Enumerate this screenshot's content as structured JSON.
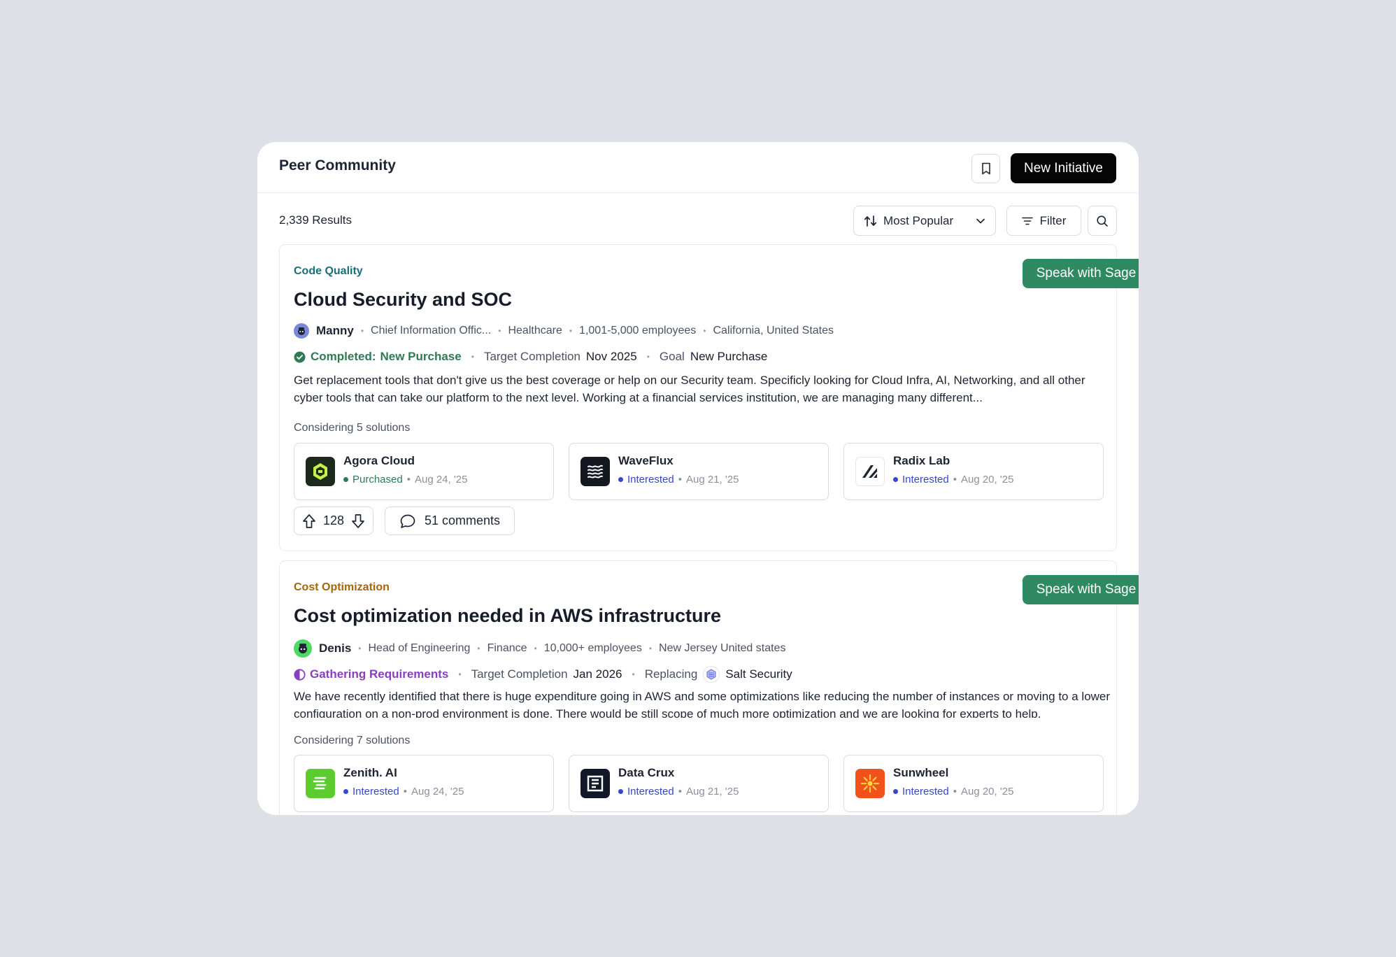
{
  "header": {
    "title": "Peer Community",
    "new_initiative_label": "New Initiative"
  },
  "toolbar": {
    "results": "2,339 Results",
    "sort_label": "Most Popular",
    "filter_label": "Filter"
  },
  "initiatives": [
    {
      "category": "Code Quality",
      "category_color": "#1b6e7a",
      "speak_label": "Speak with Sage",
      "title": "Cloud Security and SOC",
      "author": "Manny",
      "role": "Chief Information Offic...",
      "industry": "Healthcare",
      "size": "1,001-5,000 employees",
      "location": "California, United States",
      "status_label": "Completed:",
      "status_value": "New Purchase",
      "status_color": "#2f7a55",
      "target_label": "Target Completion",
      "target_value": "Nov 2025",
      "goal_label": "Goal",
      "goal_value": "New Purchase",
      "description": "Get replacement tools that don't give us the best coverage or help on our Security team. Specificly looking for Cloud Infra, AI, Networking, and all other cyber tools that can take our platform to the next level. Working at a financial services institution, we are managing many different...",
      "considering": "Considering 5 solutions",
      "solutions": [
        {
          "name": "Agora Cloud",
          "status": "Purchased",
          "status_color": "#2f7a55",
          "date": "Aug 24, '25",
          "icon": "agora-cloud-logo"
        },
        {
          "name": "WaveFlux",
          "status": "Interested",
          "status_color": "#3548c9",
          "date": "Aug 21, '25",
          "icon": "waveflux-logo"
        },
        {
          "name": "Radix Lab",
          "status": "Interested",
          "status_color": "#3548c9",
          "date": "Aug 20, '25",
          "icon": "radix-lab-logo"
        }
      ],
      "votes": "128",
      "comments": "51 comments"
    },
    {
      "category": "Cost Optimization",
      "category_color": "#a5650b",
      "speak_label": "Speak with Sage",
      "title": "Cost optimization needed in AWS infrastructure",
      "author": "Denis",
      "role": "Head of Engineering",
      "industry": "Finance",
      "size": "10,000+ employees",
      "location": "New Jersey United states",
      "status_label": "Gathering Requirements",
      "status_color": "#8a3fc0",
      "target_label": "Target Completion",
      "target_value": "Jan 2026",
      "replacing_label": "Replacing",
      "replacing_value": "Salt Security",
      "description": "We have recently identified that there is huge expenditure going in AWS and some optimizations like reducing the number of instances or moving to a lower configuration on a non-prod environment is done. There would be still scope of much more optimization and we are looking for experts to help.",
      "considering": "Considering 7 solutions",
      "solutions": [
        {
          "name": "Zenith. AI",
          "status": "Interested",
          "status_color": "#3548c9",
          "date": "Aug 24, '25",
          "icon": "zenith-ai-logo"
        },
        {
          "name": "Data Crux",
          "status": "Interested",
          "status_color": "#3548c9",
          "date": "Aug 21, '25",
          "icon": "data-crux-logo"
        },
        {
          "name": "Sunwheel",
          "status": "Interested",
          "status_color": "#3548c9",
          "date": "Aug 20, '25",
          "icon": "sunwheel-logo"
        }
      ]
    }
  ]
}
